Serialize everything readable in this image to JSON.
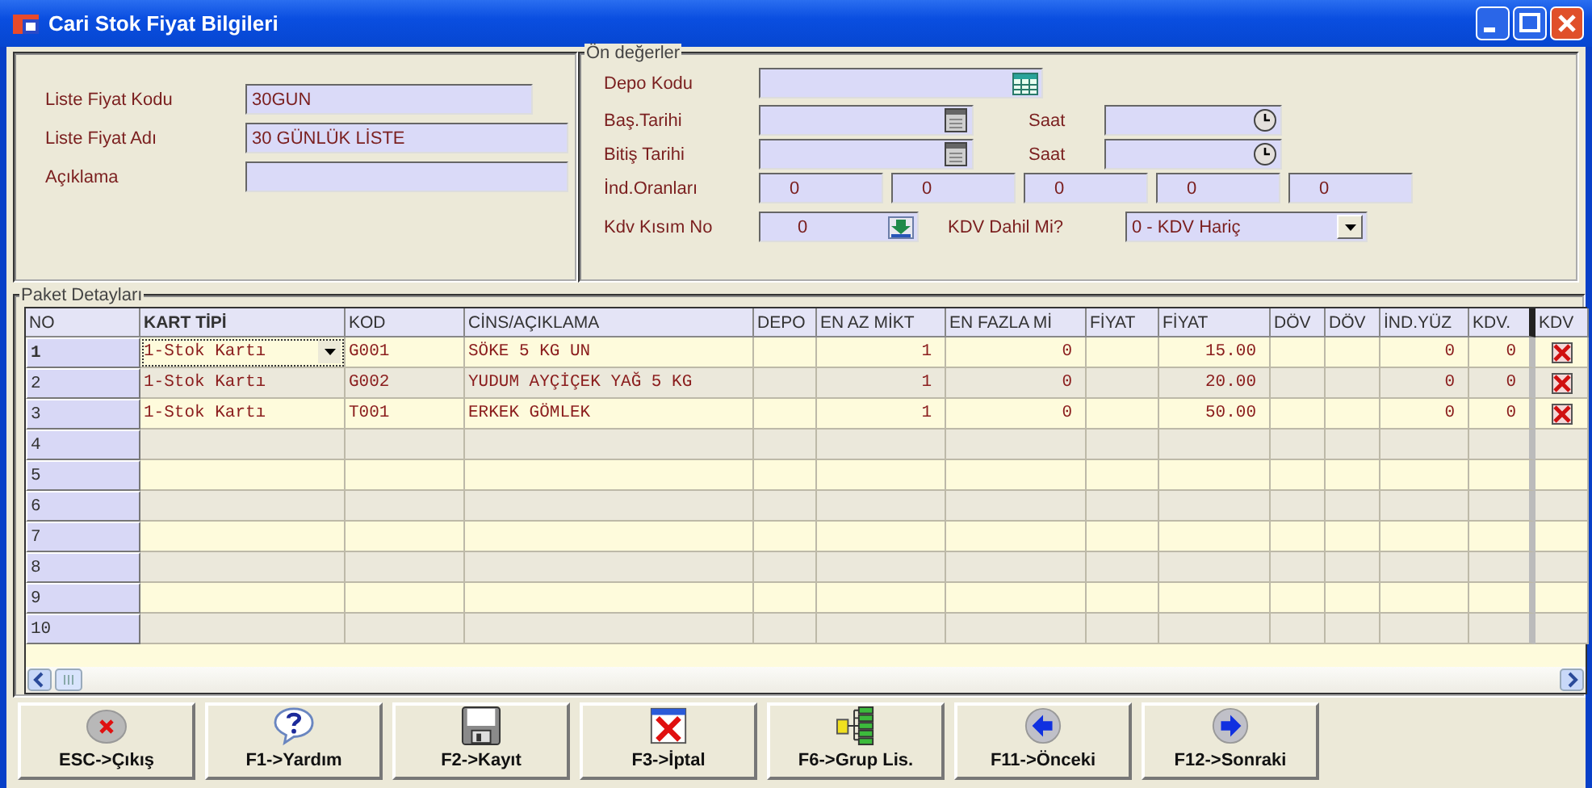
{
  "window": {
    "title": "Cari Stok Fiyat Bilgileri"
  },
  "header": {
    "fields": [
      {
        "label": "Liste Fiyat Kodu",
        "value": "30GUN"
      },
      {
        "label": "Liste Fiyat Adı",
        "value": "30 GÜNLÜK LİSTE"
      },
      {
        "label": "Açıklama"
      }
    ]
  },
  "defaults": {
    "title": "Ön değerler",
    "depo_kodu": {
      "label": "Depo Kodu"
    },
    "bas_tarihi": {
      "label": "Baş.Tarihi",
      "time_label": "Saat"
    },
    "bitis_tarihi": {
      "label": "Bitiş Tarihi",
      "time_label": "Saat"
    },
    "ind_oranlari": {
      "label": "İnd.Oranları",
      "values": [
        "0",
        "0",
        "0",
        "0",
        "0"
      ]
    },
    "kdv_kisim_no": {
      "label": "Kdv Kısım No",
      "value": "0"
    },
    "kdv_dahil": {
      "label": "KDV Dahil Mi?",
      "value": "0 - KDV Hariç"
    }
  },
  "grid": {
    "title": "Paket Detayları",
    "columns": [
      "NO",
      "KART TİPİ",
      "KOD",
      "CİNS/AÇIKLAMA",
      "DEPO",
      "EN AZ MİKT",
      "EN FAZLA Mİ",
      "FİYAT",
      "FİYAT",
      "DÖV",
      "DÖV",
      "İND.YÜZ",
      "KDV.",
      "KDV"
    ],
    "rows": [
      {
        "no": "1",
        "selected": true,
        "kart_tipi": "1-Stok Kartı",
        "kod": "G001",
        "cins": "SÖKE 5 KG UN",
        "en_az": "1",
        "en_fazla": "0",
        "fiyat": "15.00",
        "ind_yuz": "0",
        "kdv_orani": "0",
        "kdv_dahil": false
      },
      {
        "no": "2",
        "selected": false,
        "kart_tipi": "1-Stok Kartı",
        "kod": "G002",
        "cins": "YUDUM AYÇİÇEK YAĞ 5 KG",
        "en_az": "1",
        "en_fazla": "0",
        "fiyat": "20.00",
        "ind_yuz": "0",
        "kdv_orani": "0",
        "kdv_dahil": false
      },
      {
        "no": "3",
        "selected": false,
        "kart_tipi": "1-Stok Kartı",
        "kod": "T001",
        "cins": "ERKEK GÖMLEK",
        "en_az": "1",
        "en_fazla": "0",
        "fiyat": "50.00",
        "ind_yuz": "0",
        "kdv_orani": "0",
        "kdv_dahil": false
      },
      {
        "no": "4",
        "selected": false
      },
      {
        "no": "5",
        "selected": false
      },
      {
        "no": "6",
        "selected": false
      },
      {
        "no": "7",
        "selected": false
      },
      {
        "no": "8",
        "selected": false
      },
      {
        "no": "9",
        "selected": false
      },
      {
        "no": "10",
        "selected": false
      }
    ]
  },
  "buttons": [
    {
      "label": "ESC->Çıkış",
      "kind": "exit"
    },
    {
      "label": "F1->Yardım",
      "kind": "help"
    },
    {
      "label": "F2->Kayıt",
      "kind": "save"
    },
    {
      "label": "F3->İptal",
      "kind": "cancel"
    },
    {
      "label": "F6->Grup Lis.",
      "kind": "group"
    },
    {
      "label": "F11->Önceki",
      "kind": "prev"
    },
    {
      "label": "F12->Sonraki",
      "kind": "next"
    }
  ]
}
